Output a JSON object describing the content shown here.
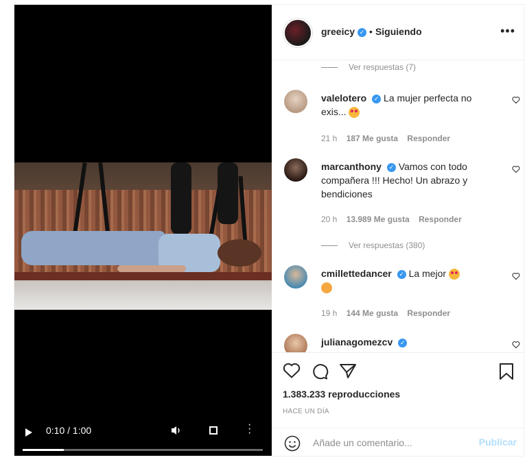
{
  "video": {
    "time": "0:10 / 1:00",
    "progress_fraction": 0.17
  },
  "header": {
    "username": "greeicy",
    "separator": "•",
    "follow_label": "Siguiendo",
    "options_label": "•••"
  },
  "comments": {
    "view_replies_top": "Ver respuestas (7)",
    "items": [
      {
        "username": "valelotero",
        "text": "La mujer perfecta no exis...",
        "time": "21 h",
        "likes": "187 Me gusta",
        "reply": "Responder"
      },
      {
        "username": "marcanthony",
        "text": "Vamos con todo compañera !!! Hecho! Un abrazo y bendiciones",
        "time": "20 h",
        "likes": "13.989 Me gusta",
        "reply": "Responder",
        "view_replies": "Ver respuestas (380)"
      },
      {
        "username": "cmillettedancer",
        "text": "La mejor",
        "time": "19 h",
        "likes": "144 Me gusta",
        "reply": "Responder"
      },
      {
        "username": "julianagomezcv"
      }
    ]
  },
  "actions": {
    "views": "1.383.233 reproducciones",
    "posted": "HACE UN DÍA"
  },
  "add_comment": {
    "placeholder": "Añade un comentario...",
    "publish_label": "Publicar"
  },
  "colors": {
    "verified": "#3897f0",
    "publish_disabled": "#b2dffc",
    "muted_text": "#8e8e8e"
  }
}
